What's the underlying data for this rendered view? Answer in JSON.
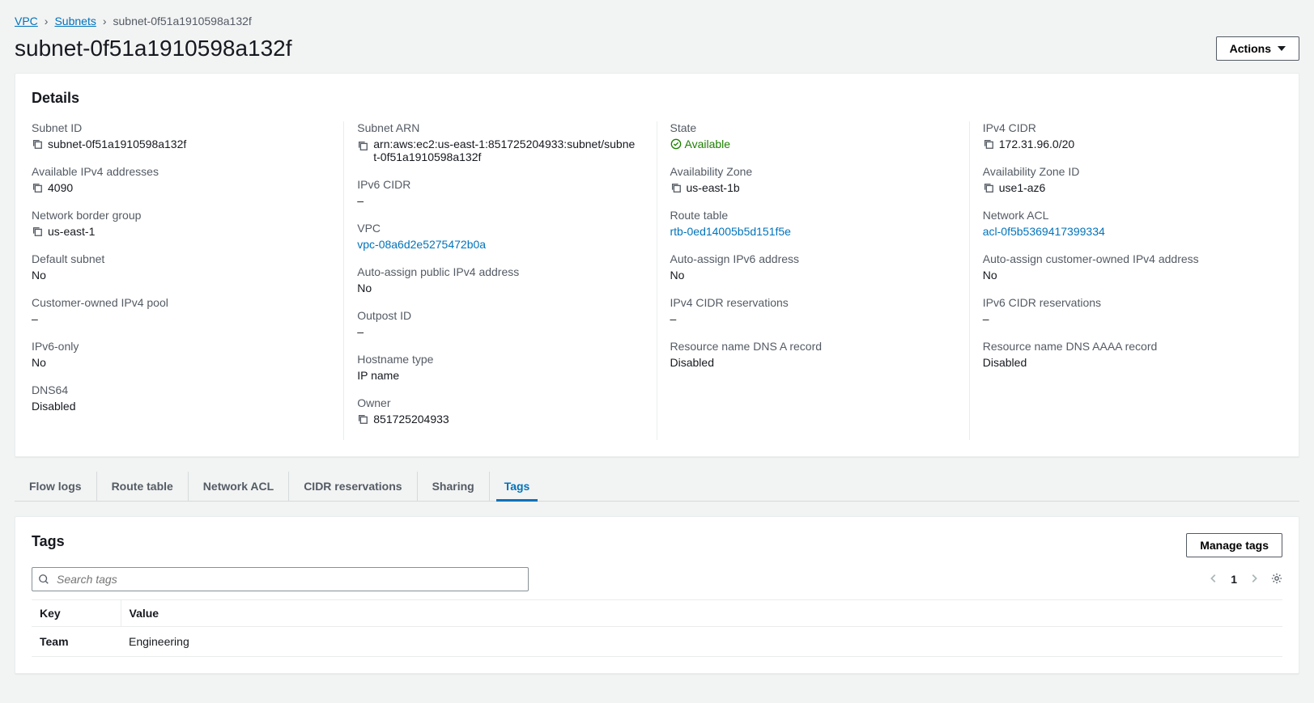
{
  "breadcrumb": {
    "vpc": "VPC",
    "subnets": "Subnets",
    "current": "subnet-0f51a1910598a132f"
  },
  "page_title": "subnet-0f51a1910598a132f",
  "actions_label": "Actions",
  "details": {
    "heading": "Details",
    "col1": {
      "subnet_id_label": "Subnet ID",
      "subnet_id_value": "subnet-0f51a1910598a132f",
      "avail_ipv4_label": "Available IPv4 addresses",
      "avail_ipv4_value": "4090",
      "nbg_label": "Network border group",
      "nbg_value": "us-east-1",
      "default_subnet_label": "Default subnet",
      "default_subnet_value": "No",
      "cust_ipv4_pool_label": "Customer-owned IPv4 pool",
      "cust_ipv4_pool_value": "–",
      "ipv6_only_label": "IPv6-only",
      "ipv6_only_value": "No",
      "dns64_label": "DNS64",
      "dns64_value": "Disabled"
    },
    "col2": {
      "subnet_arn_label": "Subnet ARN",
      "subnet_arn_value": "arn:aws:ec2:us-east-1:851725204933:subnet/subnet-0f51a1910598a132f",
      "ipv6_cidr_label": "IPv6 CIDR",
      "ipv6_cidr_value": "–",
      "vpc_label": "VPC",
      "vpc_value": "vpc-08a6d2e5275472b0a",
      "auto_pub_ipv4_label": "Auto-assign public IPv4 address",
      "auto_pub_ipv4_value": "No",
      "outpost_label": "Outpost ID",
      "outpost_value": "–",
      "hostname_type_label": "Hostname type",
      "hostname_type_value": "IP name",
      "owner_label": "Owner",
      "owner_value": "851725204933"
    },
    "col3": {
      "state_label": "State",
      "state_value": "Available",
      "az_label": "Availability Zone",
      "az_value": "us-east-1b",
      "route_table_label": "Route table",
      "route_table_value": "rtb-0ed14005b5d151f5e",
      "auto_ipv6_label": "Auto-assign IPv6 address",
      "auto_ipv6_value": "No",
      "ipv4_res_label": "IPv4 CIDR reservations",
      "ipv4_res_value": "–",
      "dns_a_label": "Resource name DNS A record",
      "dns_a_value": "Disabled"
    },
    "col4": {
      "ipv4_cidr_label": "IPv4 CIDR",
      "ipv4_cidr_value": "172.31.96.0/20",
      "az_id_label": "Availability Zone ID",
      "az_id_value": "use1-az6",
      "nacl_label": "Network ACL",
      "nacl_value": "acl-0f5b5369417399334",
      "auto_cust_ipv4_label": "Auto-assign customer-owned IPv4 address",
      "auto_cust_ipv4_value": "No",
      "ipv6_res_label": "IPv6 CIDR reservations",
      "ipv6_res_value": "–",
      "dns_aaaa_label": "Resource name DNS AAAA record",
      "dns_aaaa_value": "Disabled"
    }
  },
  "tabs": {
    "flow_logs": "Flow logs",
    "route_table": "Route table",
    "network_acl": "Network ACL",
    "cidr_res": "CIDR reservations",
    "sharing": "Sharing",
    "tags": "Tags"
  },
  "tags_panel": {
    "heading": "Tags",
    "manage_label": "Manage tags",
    "search_placeholder": "Search tags",
    "page_num": "1",
    "key_header": "Key",
    "value_header": "Value",
    "rows": [
      {
        "key": "Team",
        "value": "Engineering"
      }
    ]
  }
}
